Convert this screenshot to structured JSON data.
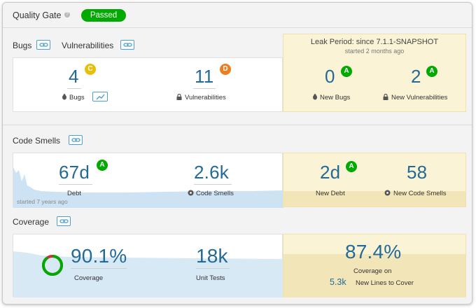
{
  "quality_gate": {
    "title": "Quality Gate",
    "help_icon": "question-icon",
    "status": "Passed",
    "status_color": "#00aa00"
  },
  "bugs_section": {
    "bugs_label": "Bugs",
    "vulnerabilities_label": "Vulnerabilities",
    "bugs_value": "4",
    "bugs_rating": "C",
    "bugs_metric_label": "Bugs",
    "vulnerabilities_value": "11",
    "vulnerabilities_rating": "D",
    "vulnerabilities_metric_label": "Vulnerabilities"
  },
  "leak_period": {
    "title": "Leak Period: since 7.1.1-SNAPSHOT",
    "subtitle": "started 2 months ago",
    "new_bugs_value": "0",
    "new_bugs_rating": "A",
    "new_bugs_label": "New Bugs",
    "new_vulnerabilities_value": "2",
    "new_vulnerabilities_rating": "A",
    "new_vulnerabilities_label": "New Vulnerabilities"
  },
  "code_smells": {
    "section_label": "Code Smells",
    "debt_value": "67d",
    "debt_rating": "A",
    "debt_label": "Debt",
    "code_smells_value": "2.6k",
    "code_smells_label": "Code Smells",
    "started_note": "started 7 years ago",
    "new_debt_value": "2d",
    "new_debt_rating": "A",
    "new_debt_label": "New Debt",
    "new_code_smells_value": "58",
    "new_code_smells_label": "New Code Smells"
  },
  "coverage": {
    "section_label": "Coverage",
    "coverage_value": "90.1%",
    "coverage_label": "Coverage",
    "coverage_fraction": 0.901,
    "unit_tests_value": "18k",
    "unit_tests_label": "Unit Tests",
    "new_coverage_value": "87.4%",
    "new_coverage_label": "Coverage on",
    "new_lines_value": "5.3k",
    "new_lines_label": "New Lines to Cover"
  },
  "colors": {
    "accent": "#236a97",
    "rating_a": "#00aa00",
    "rating_c": "#eabe06",
    "rating_d": "#ed7d20",
    "leak_bg": "#fbf3d5"
  }
}
